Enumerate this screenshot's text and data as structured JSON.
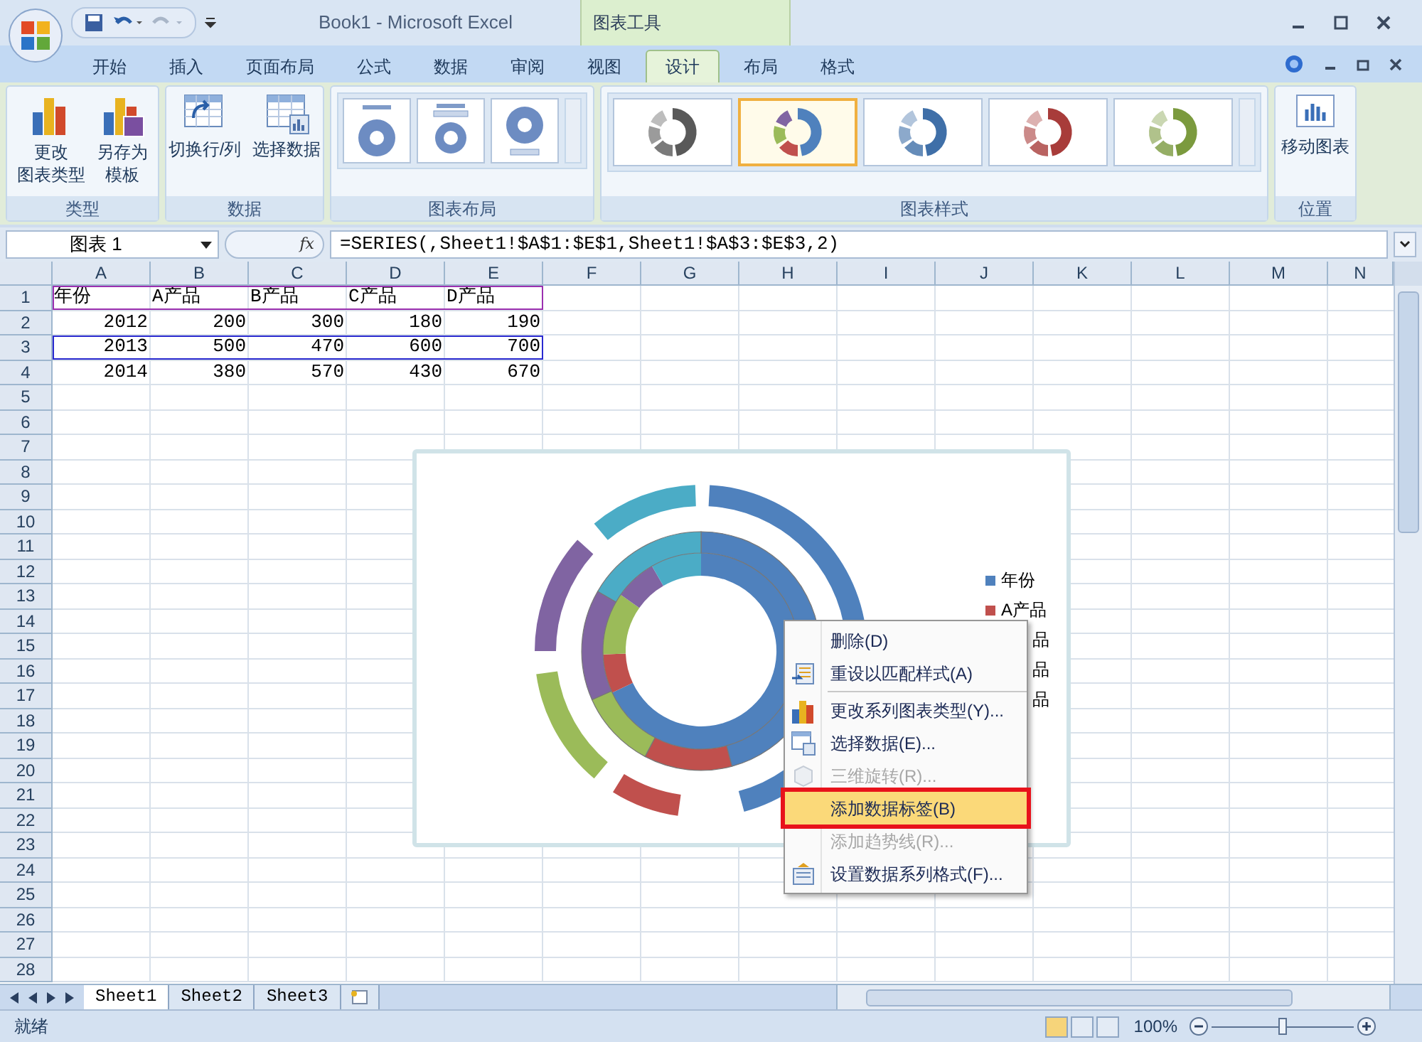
{
  "title_bar": {
    "title": "Book1 - Microsoft Excel",
    "contextual_tab": "图表工具"
  },
  "tabs": [
    {
      "label": "开始",
      "selected": false
    },
    {
      "label": "插入",
      "selected": false
    },
    {
      "label": "页面布局",
      "selected": false
    },
    {
      "label": "公式",
      "selected": false
    },
    {
      "label": "数据",
      "selected": false
    },
    {
      "label": "审阅",
      "selected": false
    },
    {
      "label": "视图",
      "selected": false
    },
    {
      "label": "设计",
      "selected": true
    },
    {
      "label": "布局",
      "selected": false
    },
    {
      "label": "格式",
      "selected": false
    }
  ],
  "ribbon": {
    "groups": [
      {
        "kind": "buttons",
        "label": "类型",
        "buttons": [
          [
            "更改",
            "图表类型"
          ],
          [
            "另存为",
            "模板"
          ]
        ]
      },
      {
        "kind": "buttons",
        "label": "数据",
        "buttons": [
          [
            "切换行/列"
          ],
          [
            "选择数据"
          ]
        ]
      },
      {
        "kind": "layouts",
        "label": "图表布局"
      },
      {
        "kind": "styles",
        "label": "图表样式",
        "styles": [
          {
            "kind": "mono",
            "color": "#595959",
            "selected": false
          },
          {
            "kind": "multi",
            "color": "#4f81bd",
            "selected": true
          },
          {
            "kind": "mono",
            "color": "#3f6fa8",
            "selected": false
          },
          {
            "kind": "mono",
            "color": "#a83c3a",
            "selected": false
          },
          {
            "kind": "mono",
            "color": "#7b9a3e",
            "selected": false
          }
        ]
      },
      {
        "kind": "buttons",
        "label": "位置",
        "buttons": [
          [
            "移动图表"
          ]
        ]
      }
    ]
  },
  "formula_bar": {
    "name_box": "图表 1",
    "function_label": "fx",
    "formula": "=SERIES(,Sheet1!$A$1:$E$1,Sheet1!$A$3:$E$3,2)"
  },
  "sheet": {
    "columns": [
      "A",
      "B",
      "C",
      "D",
      "E",
      "F",
      "G",
      "H",
      "I",
      "J",
      "K",
      "L",
      "M",
      "N"
    ],
    "rows": [
      {
        "header": "1",
        "kind": "text",
        "color": "#9b30b0",
        "cells": [
          "年份",
          "A产品",
          "B产品",
          "C产品",
          "D产品"
        ]
      },
      {
        "header": "2",
        "kind": "number",
        "cells": [
          "2012",
          "200",
          "300",
          "180",
          "190"
        ]
      },
      {
        "header": "3",
        "kind": "number",
        "color": "#2a2ad0",
        "cells": [
          "2013",
          "500",
          "470",
          "600",
          "700"
        ]
      },
      {
        "header": "4",
        "kind": "number",
        "cells": [
          "2014",
          "380",
          "570",
          "430",
          "670"
        ]
      },
      {
        "header": "5"
      },
      {
        "header": "6"
      },
      {
        "header": "7"
      },
      {
        "header": "8"
      },
      {
        "header": "9"
      },
      {
        "header": "10"
      },
      {
        "header": "11"
      },
      {
        "header": "12"
      },
      {
        "header": "13"
      },
      {
        "header": "14"
      },
      {
        "header": "15"
      },
      {
        "header": "16"
      },
      {
        "header": "17"
      },
      {
        "header": "18"
      },
      {
        "header": "19"
      },
      {
        "header": "20"
      },
      {
        "header": "21"
      },
      {
        "header": "22"
      },
      {
        "header": "23"
      },
      {
        "header": "24"
      },
      {
        "header": "25"
      },
      {
        "header": "26"
      },
      {
        "header": "27"
      },
      {
        "header": "28"
      }
    ]
  },
  "chart": {
    "legend": [
      {
        "kind": "full",
        "label": "年份",
        "color": "#4f81bd"
      },
      {
        "kind": "full",
        "label": "A产品",
        "color": "#c0504d"
      },
      {
        "kind": "partial",
        "label": "品"
      },
      {
        "kind": "partial",
        "label": "品"
      },
      {
        "kind": "partial",
        "label": "品"
      }
    ]
  },
  "context_menu": {
    "items": [
      {
        "label": "删除(D)",
        "disabled": false,
        "selected": false,
        "separator_after": false
      },
      {
        "label": "重设以匹配样式(A)",
        "disabled": false,
        "selected": false,
        "separator_after": true
      },
      {
        "label": "更改系列图表类型(Y)...",
        "disabled": false,
        "selected": false,
        "separator_after": false
      },
      {
        "label": "选择数据(E)...",
        "disabled": false,
        "selected": false,
        "separator_after": false
      },
      {
        "label": "三维旋转(R)...",
        "disabled": true,
        "selected": false,
        "separator_after": false
      },
      {
        "label": "添加数据标签(B)",
        "disabled": false,
        "selected": true,
        "separator_after": false
      },
      {
        "label": "添加趋势线(R)...",
        "disabled": true,
        "selected": false,
        "separator_after": false
      },
      {
        "label": "设置数据系列格式(F)...",
        "disabled": false,
        "selected": false,
        "separator_after": false
      }
    ]
  },
  "sheet_tabs": [
    {
      "label": "Sheet1",
      "selected": true
    },
    {
      "label": "Sheet2",
      "selected": false
    },
    {
      "label": "Sheet3",
      "selected": false
    }
  ],
  "status_bar": {
    "status": "就绪",
    "zoom": "100%",
    "level": 0.5
  }
}
